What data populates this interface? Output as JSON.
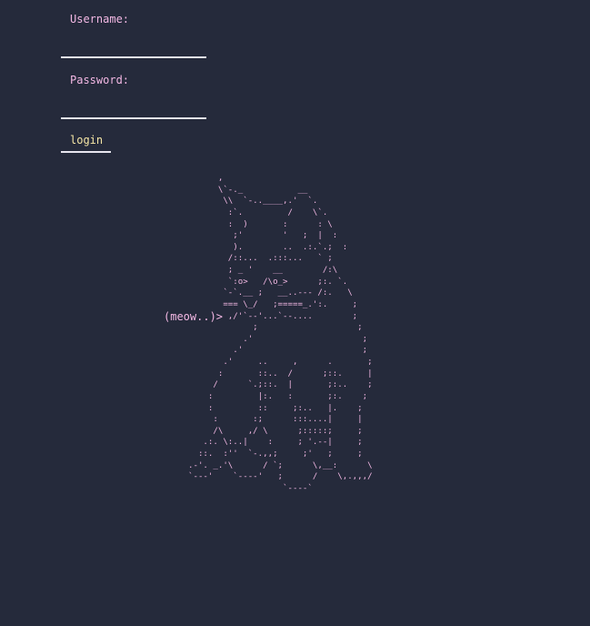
{
  "form": {
    "username_label": "Username:",
    "username_value": "",
    "password_label": "Password:",
    "password_value": "",
    "login_label": "login"
  },
  "meow_text": "(meow..)>",
  "ascii_art": "      ,\n      \\`-._           __\n       \\\\  `-..____,.'  `.\n        :`.         /    \\`.\n        :  )       :      : \\\n         ;'        '   ;  |  :\n         ).        ..  .:.`.;  :\n        /::...  .:::...   ` ;\n        ; _ '    __        /:\\\n        `:o>   /\\o_>      ;:. `.\n       `-`.__ ;   __..--- /:.   \\\n       === \\_/   ;=====_.':.     ;\n        ,/'`--'...`--....        ;\n             ;                    ;\n           .'                      ;\n         .'                        ;\n       .'     ..     ,      .       ;\n      :       ::..  /      ;::.     |\n     /      `.;::.  |       ;:..    ;\n    :         |:.   :       ;:.    ;\n    :         ::     ;:..   |.    ;\n     :       :;      :::....|     |\n     /\\     ,/ \\      ;:::::;     ;\n   .:. \\:..|    :     ; '.--|     ;\n  ::.  :''  `-.,,;     ;'   ;     ;\n.-'. _.'\\      / `;      \\,__:      \\\n`---'    `----'   ;      /    \\,.,,,/\n                   `----`",
  "colors": {
    "background": "#252a3b",
    "label_pink": "#f3b8e4",
    "button_yellow": "#f6e6a6",
    "underline": "#e8e6ef"
  }
}
